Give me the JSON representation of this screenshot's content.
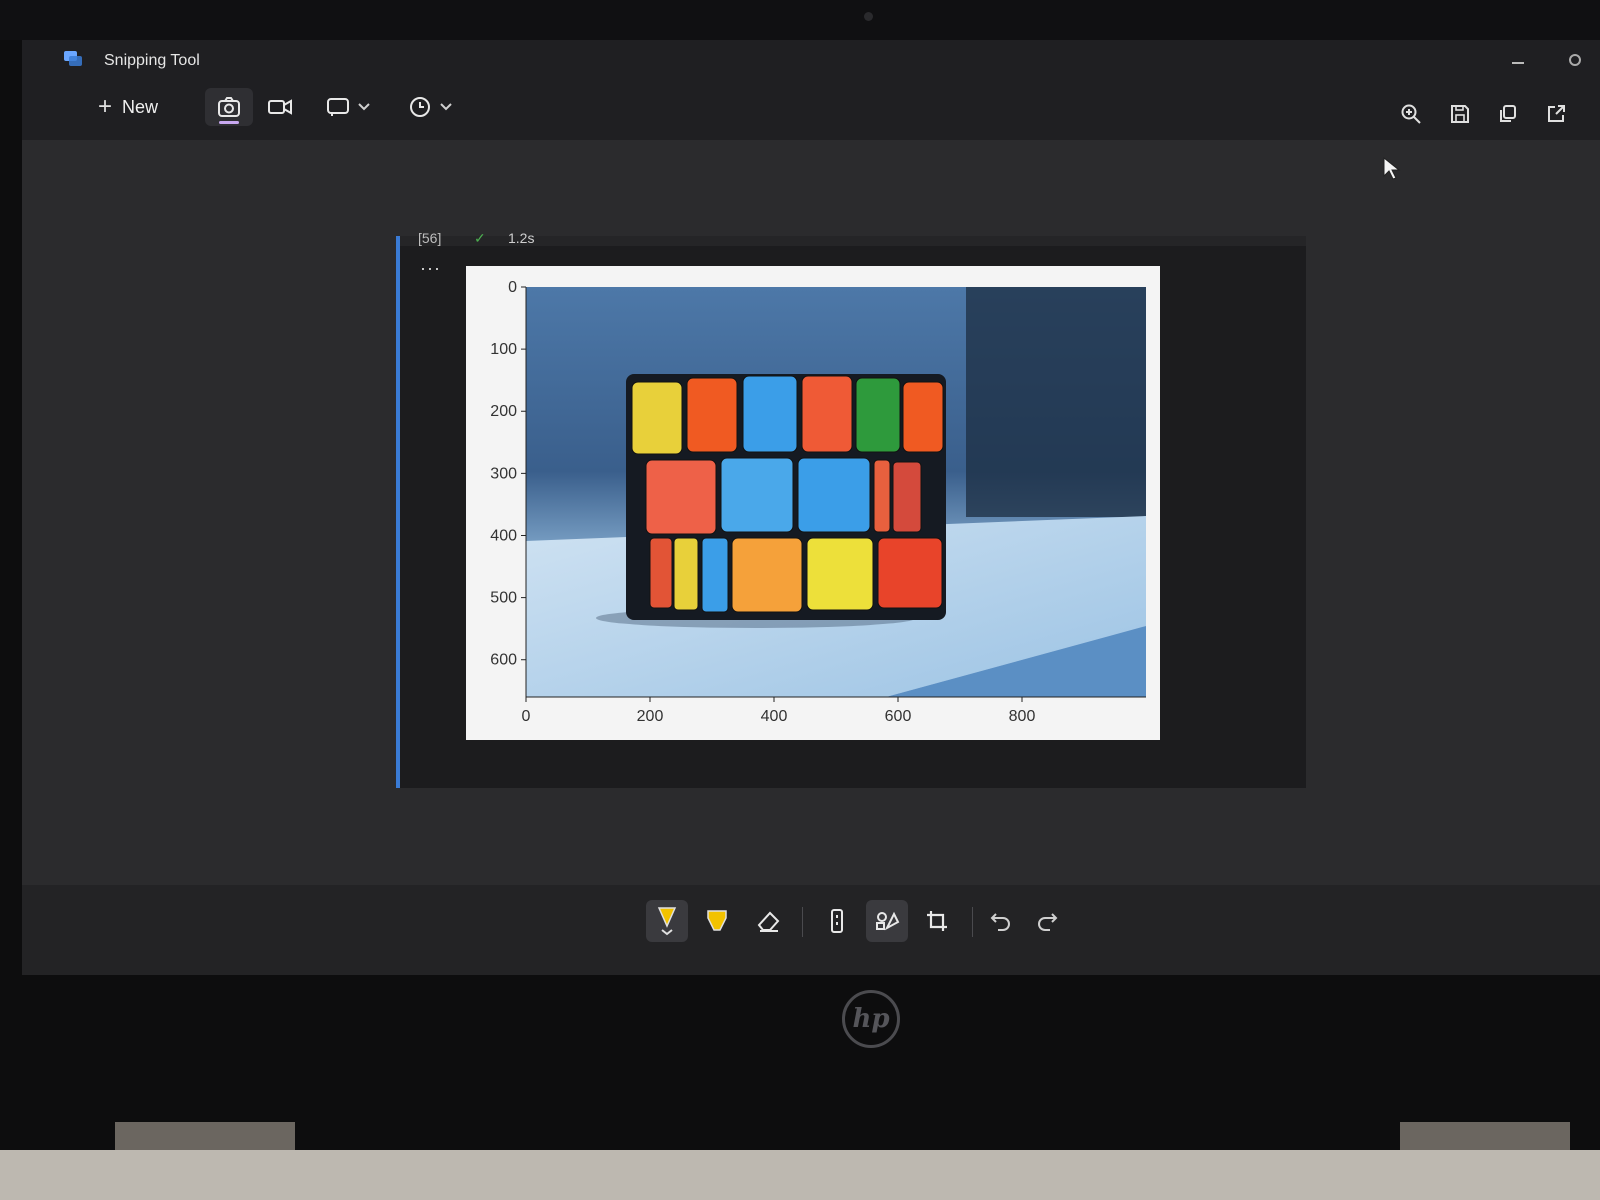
{
  "app": {
    "title": "Snipping Tool"
  },
  "toolbar": {
    "new_label": "New",
    "new_icon": "plus-icon",
    "modes": [
      "camera-icon",
      "video-icon"
    ],
    "active_mode": "camera-icon",
    "snip_shape_icon": "rectangle-snip-icon",
    "timer_icon": "clock-icon",
    "right_icons": [
      "zoom-in-icon",
      "save-icon",
      "copy-icon",
      "share-icon"
    ]
  },
  "snip": {
    "exec_count": "[56]",
    "exec_time": "1.2s",
    "more": "···"
  },
  "chart_data": {
    "type": "image",
    "xticks": [
      "0",
      "200",
      "400",
      "600",
      "800"
    ],
    "yticks": [
      "0",
      "100",
      "200",
      "300",
      "400",
      "500",
      "600"
    ],
    "xlim": [
      0,
      1000
    ],
    "ylim": [
      660,
      0
    ],
    "title": "",
    "xlabel": "",
    "ylabel": ""
  },
  "markup": {
    "icons": [
      "ballpoint-pen-icon",
      "highlighter-icon",
      "eraser-icon",
      "ruler-icon",
      "shapes-icon",
      "crop-icon",
      "undo-icon",
      "redo-icon"
    ],
    "selected": "ballpoint-pen-icon",
    "accent": "#f2c200"
  },
  "colors": {
    "accent_purple": "#c8a8f0",
    "cell_rule": "#3a7bd5"
  },
  "device": {
    "logo": "hp"
  }
}
